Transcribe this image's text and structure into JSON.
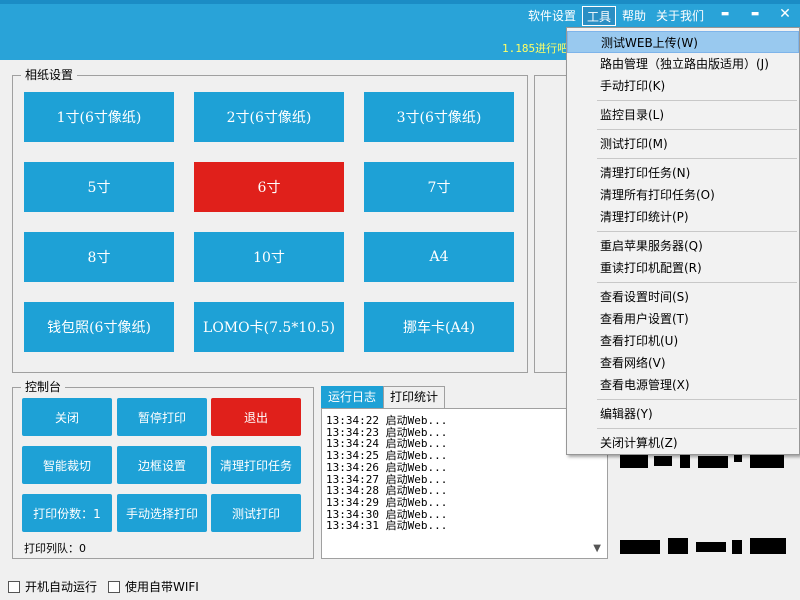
{
  "menubar": {
    "items": [
      "软件设置",
      "工具",
      "帮助",
      "关于我们"
    ],
    "active_index": 1
  },
  "window_controls": {
    "minimize": "▬",
    "maximize": "▬",
    "close": "✕"
  },
  "marquee_text": "1.185进行吧",
  "paper_group": {
    "title": "相纸设置",
    "buttons": [
      "1寸(6寸像纸)",
      "2寸(6寸像纸)",
      "3寸(6寸像纸)",
      "5寸",
      "6寸",
      "7寸",
      "8寸",
      "10寸",
      "A4",
      "钱包照(6寸像纸)",
      "LOMO卡(7.5*10.5)",
      "挪车卡(A4)"
    ],
    "selected_index": 4
  },
  "console_group": {
    "title": "控制台",
    "buttons": [
      "关闭",
      "暂停打印",
      "退出",
      "智能裁切",
      "边框设置",
      "清理打印任务",
      "打印份数：1",
      "手动选择打印",
      "测试打印"
    ],
    "queue_label": "打印列队：0"
  },
  "log": {
    "tabs": [
      "运行日志",
      "打印统计"
    ],
    "active_tab": 0,
    "lines": [
      "13:34:22 启动Web...",
      "13:34:23 启动Web...",
      "13:34:24 启动Web...",
      "13:34:25 启动Web...",
      "13:34:26 启动Web...",
      "13:34:27 启动Web...",
      "13:34:28 启动Web...",
      "13:34:29 启动Web...",
      "13:34:30 启动Web...",
      "13:34:31 启动Web..."
    ]
  },
  "bottom_bar": {
    "auto_run_label": "开机自动运行",
    "wifi_label": "使用自带WIFI"
  },
  "dropdown": {
    "groups": [
      [
        "测试WEB上传(W)",
        "路由管理（独立路由版适用）(J)",
        "手动打印(K)"
      ],
      [
        "监控目录(L)"
      ],
      [
        "测试打印(M)"
      ],
      [
        "清理打印任务(N)",
        "清理所有打印任务(O)",
        "清理打印统计(P)"
      ],
      [
        "重启苹果服务器(Q)",
        "重读打印机配置(R)"
      ],
      [
        "查看设置时间(S)",
        "查看用户设置(T)",
        "查看打印机(U)",
        "查看网络(V)",
        "查看电源管理(X)"
      ],
      [
        "编辑器(Y)"
      ],
      [
        "关闭计算机(Z)"
      ]
    ],
    "highlighted": "测试WEB上传(W)"
  },
  "colors": {
    "title_bar": "#29a3d8",
    "button_blue": "#1ea1d6",
    "button_red": "#e0201b",
    "menu_highlight": "#99c9ef"
  }
}
